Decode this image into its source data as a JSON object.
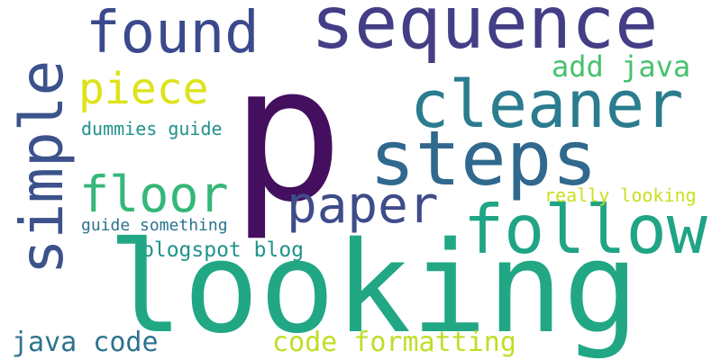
{
  "words": [
    {
      "id": "p",
      "text": "p",
      "color": "#440f5e"
    },
    {
      "id": "sequence",
      "text": "sequence",
      "color": "#433e85"
    },
    {
      "id": "found",
      "text": "found",
      "color": "#3b4a8c"
    },
    {
      "id": "simple",
      "text": "simple",
      "color": "#3b528b"
    },
    {
      "id": "cleaner",
      "text": "cleaner",
      "color": "#2a7c8e"
    },
    {
      "id": "steps",
      "text": "steps",
      "color": "#30688e"
    },
    {
      "id": "piece",
      "text": "piece",
      "color": "#dde318"
    },
    {
      "id": "add-java",
      "text": "add java",
      "color": "#47c16e"
    },
    {
      "id": "dummies-guide",
      "text": "dummies guide",
      "color": "#21918c"
    },
    {
      "id": "floor",
      "text": "floor",
      "color": "#35b779"
    },
    {
      "id": "paper",
      "text": "paper",
      "color": "#3e4c8a"
    },
    {
      "id": "follow",
      "text": "follow",
      "color": "#20a486"
    },
    {
      "id": "really-looking",
      "text": "really looking",
      "color": "#c8e020"
    },
    {
      "id": "guide-something",
      "text": "guide something",
      "color": "#2c728e"
    },
    {
      "id": "blogspot-blog",
      "text": "blogspot blog",
      "color": "#1f948c"
    },
    {
      "id": "looking",
      "text": "looking",
      "color": "#22a785"
    },
    {
      "id": "java-code",
      "text": "java code",
      "color": "#2c738e"
    },
    {
      "id": "code-formatting",
      "text": "code formatting",
      "color": "#bddf26"
    }
  ]
}
